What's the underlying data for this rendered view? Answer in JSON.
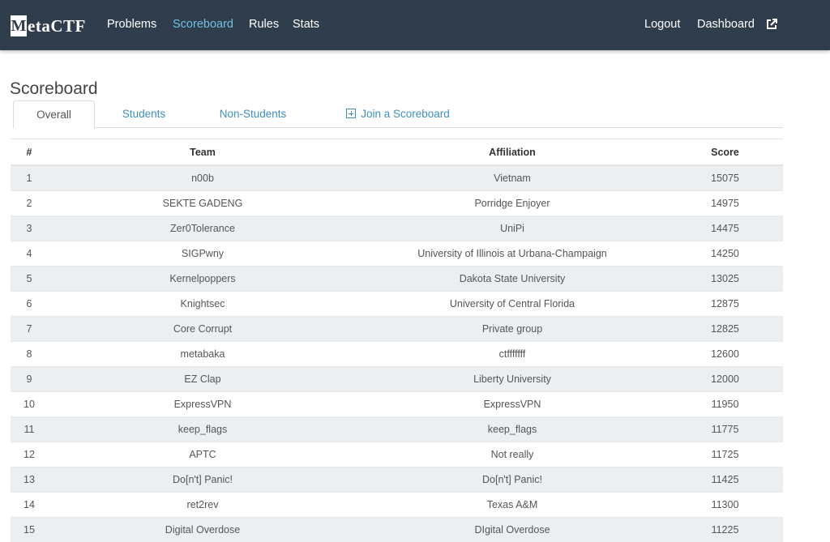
{
  "brand": {
    "logo_letter": "M",
    "logo_rest": "etaCTF"
  },
  "nav": {
    "problems": "Problems",
    "scoreboard": "Scoreboard",
    "rules": "Rules",
    "stats": "Stats",
    "logout": "Logout",
    "dashboard": "Dashboard"
  },
  "colors": {
    "topbar": "#2f3d4c",
    "active_nav": "#6fc0e3",
    "link": "#3e8fbe",
    "stripe": "#eceff1"
  },
  "page": {
    "title": "Scoreboard"
  },
  "tabs": {
    "overall": "Overall",
    "students": "Students",
    "non_students": "Non-Students",
    "join": "Join a Scoreboard"
  },
  "table": {
    "headers": {
      "rank": "#",
      "team": "Team",
      "affiliation": "Affiliation",
      "score": "Score"
    },
    "rows": [
      {
        "rank": "1",
        "team": "n00b",
        "affiliation": "Vietnam",
        "score": "15075"
      },
      {
        "rank": "2",
        "team": "SEKTE GADENG",
        "affiliation": "Porridge Enjoyer",
        "score": "14975"
      },
      {
        "rank": "3",
        "team": "Zer0Tolerance",
        "affiliation": "UniPi",
        "score": "14475"
      },
      {
        "rank": "4",
        "team": "SIGPwny",
        "affiliation": "University of Illinois at Urbana-Champaign",
        "score": "14250"
      },
      {
        "rank": "5",
        "team": "Kernelpoppers",
        "affiliation": "Dakota State University",
        "score": "13025"
      },
      {
        "rank": "6",
        "team": "Knightsec",
        "affiliation": "University of Central Florida",
        "score": "12875"
      },
      {
        "rank": "7",
        "team": "Core Corrupt",
        "affiliation": "Private group",
        "score": "12825"
      },
      {
        "rank": "8",
        "team": "metabaka",
        "affiliation": "ctfffffff",
        "score": "12600"
      },
      {
        "rank": "9",
        "team": "EZ Clap",
        "affiliation": "Liberty University",
        "score": "12000"
      },
      {
        "rank": "10",
        "team": "ExpressVPN",
        "affiliation": "ExpressVPN",
        "score": "11950"
      },
      {
        "rank": "11",
        "team": "keep_flags",
        "affiliation": "keep_flags",
        "score": "11775"
      },
      {
        "rank": "12",
        "team": "APTC",
        "affiliation": "Not really",
        "score": "11725"
      },
      {
        "rank": "13",
        "team": "Do[n't] Panic!",
        "affiliation": "Do[n't] Panic!",
        "score": "11425"
      },
      {
        "rank": "14",
        "team": "ret2rev",
        "affiliation": "Texas A&M",
        "score": "11300"
      },
      {
        "rank": "15",
        "team": "Digital Overdose",
        "affiliation": "DIgital Overdose",
        "score": "11225"
      }
    ]
  }
}
